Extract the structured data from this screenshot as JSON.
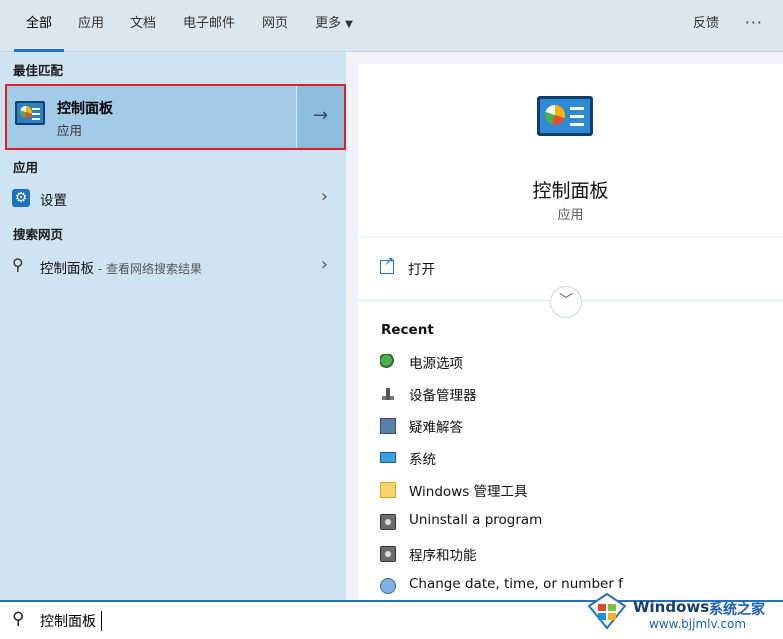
{
  "tabs": {
    "items": [
      {
        "label": "全部"
      },
      {
        "label": "应用"
      },
      {
        "label": "文档"
      },
      {
        "label": "电子邮件"
      },
      {
        "label": "网页"
      },
      {
        "label": "更多"
      }
    ],
    "feedback": "反馈",
    "more_dots": "···"
  },
  "left": {
    "best_match_heading": "最佳匹配",
    "best_match": {
      "title": "控制面板",
      "subtitle": "应用",
      "arrow": "→"
    },
    "apps_heading": "应用",
    "settings_label": "设置",
    "web_heading": "搜索网页",
    "web_result": {
      "label": "控制面板",
      "sub": " - 查看网络搜索结果"
    },
    "chevron": "›"
  },
  "right": {
    "title": "控制面板",
    "subtitle": "应用",
    "open_label": "打开",
    "recent_heading": "Recent",
    "recent_items": [
      {
        "label": "电源选项",
        "icon": "power-options-icon"
      },
      {
        "label": "设备管理器",
        "icon": "device-manager-icon"
      },
      {
        "label": "疑难解答",
        "icon": "troubleshoot-icon"
      },
      {
        "label": "系统",
        "icon": "system-icon"
      },
      {
        "label": "Windows 管理工具",
        "icon": "folder-icon"
      },
      {
        "label": "Uninstall a program",
        "icon": "program-icon"
      },
      {
        "label": "程序和功能",
        "icon": "program-icon"
      },
      {
        "label": "Change date, time, or number f",
        "icon": "clock-icon"
      }
    ]
  },
  "search": {
    "value": "控制面板"
  },
  "watermark": {
    "brand": "Windows",
    "cn": "系统之家",
    "url": "www.bjjmlv.com"
  },
  "colors": {
    "accent": "#1a73c8",
    "highlight_border": "#e11f1f"
  }
}
